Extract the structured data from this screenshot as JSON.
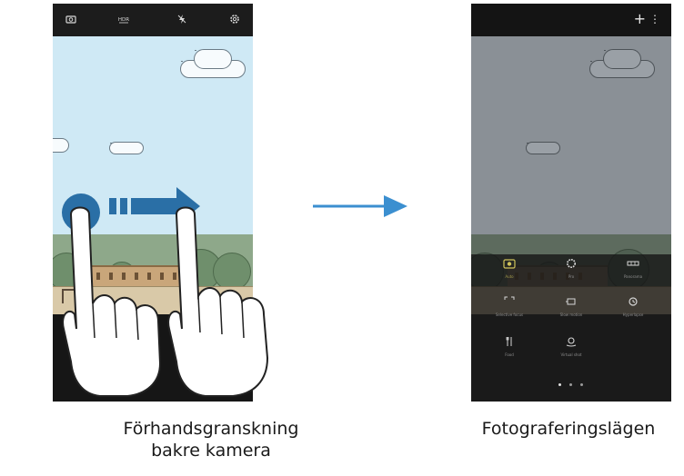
{
  "left_screen": {
    "caption": "Förhandsgranskning bakre kamera",
    "top_bar_icons": [
      "settings-camera-icon",
      "hdr-icon",
      "flash-off-icon",
      "gear-icon"
    ],
    "gesture": "swipe-right"
  },
  "right_screen": {
    "caption": "Fotograferingslägen",
    "top_bar": {
      "add_label": "+",
      "more_label": "⋮"
    },
    "modes": [
      {
        "icon": "auto-mode-icon",
        "label": "Auto",
        "active": true
      },
      {
        "icon": "pro-mode-icon",
        "label": "Pro"
      },
      {
        "icon": "panorama-icon",
        "label": "Panorama"
      },
      {
        "icon": "selective-focus-icon",
        "label": "Selective focus"
      },
      {
        "icon": "slow-motion-icon",
        "label": "Slow motion"
      },
      {
        "icon": "hyperlapse-icon",
        "label": "Hyperlapse"
      },
      {
        "icon": "food-icon",
        "label": "Food"
      },
      {
        "icon": "virtual-shot-icon",
        "label": "Virtual shot"
      }
    ],
    "page_indicator": {
      "pages": 3,
      "current": 1
    }
  },
  "colors": {
    "accent": "#2a6fa6",
    "arrow": "#3b8fd0"
  }
}
